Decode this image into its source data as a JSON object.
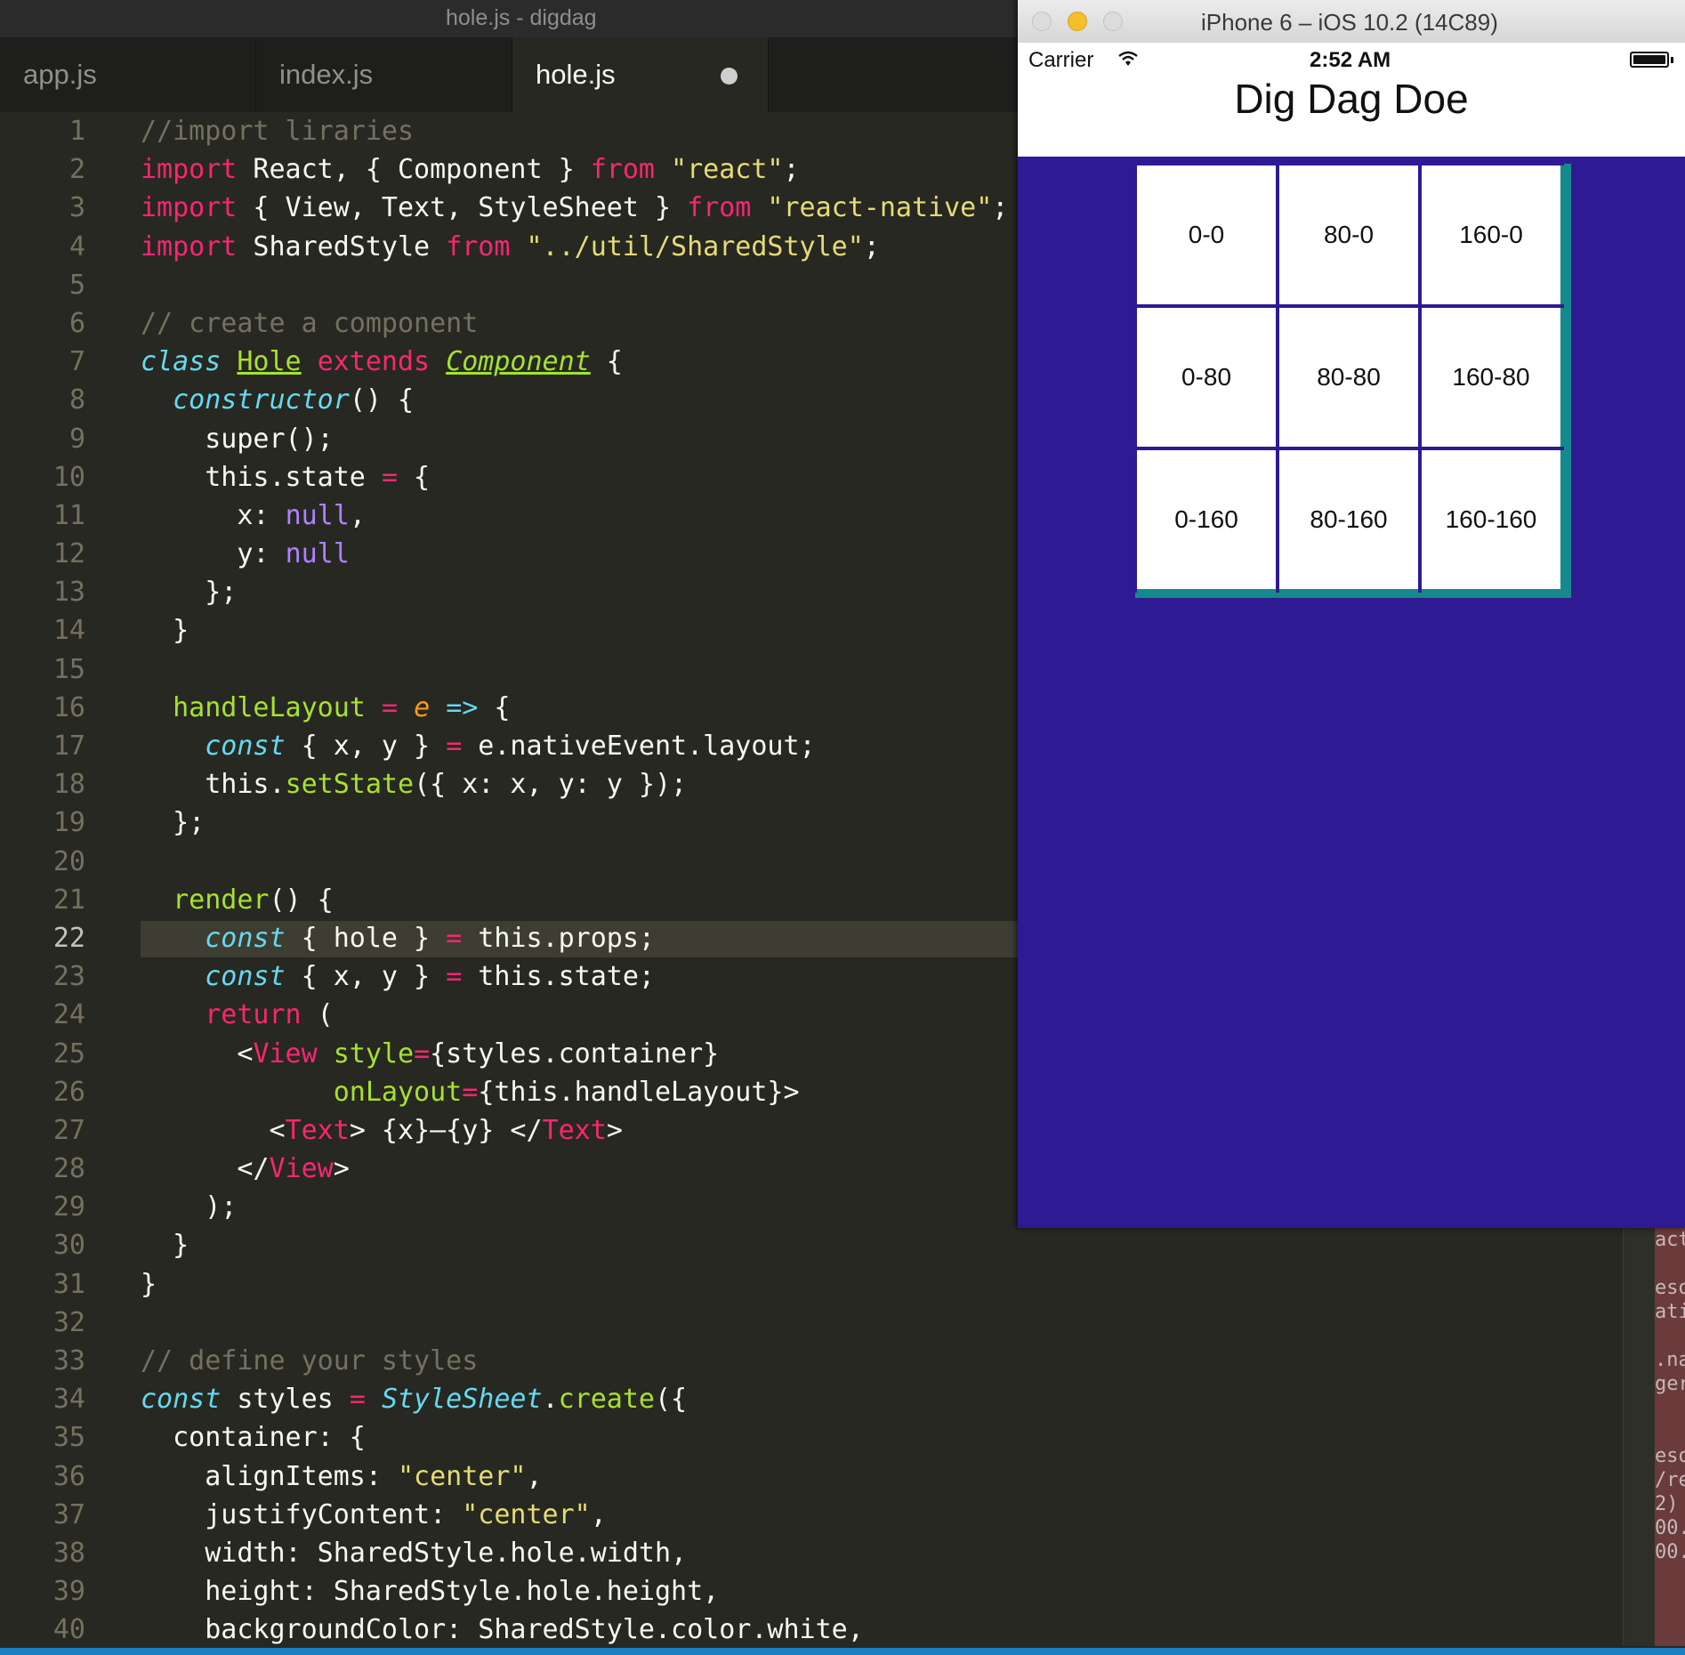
{
  "editor": {
    "window_title": "hole.js - digdag",
    "tabs": [
      {
        "label": "app.js"
      },
      {
        "label": "index.js"
      },
      {
        "label": "hole.js",
        "modified": true
      }
    ],
    "current_line": 22,
    "line_numbers": [
      "1",
      "2",
      "3",
      "4",
      "5",
      "6",
      "7",
      "8",
      "9",
      "10",
      "11",
      "12",
      "13",
      "14",
      "15",
      "16",
      "17",
      "18",
      "19",
      "20",
      "21",
      "22",
      "23",
      "24",
      "25",
      "26",
      "27",
      "28",
      "29",
      "30",
      "31",
      "32",
      "33",
      "34",
      "35",
      "36",
      "37",
      "38",
      "39",
      "40"
    ],
    "side_panel_fragments": [
      "act",
      "",
      "eso",
      "ati",
      "",
      ".na",
      "ger",
      "",
      "",
      "eso",
      "/re",
      "2)",
      "00.",
      "00."
    ]
  },
  "simulator": {
    "window_title": "iPhone 6 – iOS 10.2 (14C89)",
    "status": {
      "carrier": "Carrier",
      "time": "2:52 AM"
    },
    "app_title": "Dig Dag Doe",
    "grid": [
      [
        "0-0",
        "80-0",
        "160-0"
      ],
      [
        "0-80",
        "80-80",
        "160-80"
      ],
      [
        "0-160",
        "80-160",
        "160-160"
      ]
    ],
    "colors": {
      "background": "#2e1a93",
      "board_border": "#158a8c",
      "cell": "#ffffff"
    }
  }
}
